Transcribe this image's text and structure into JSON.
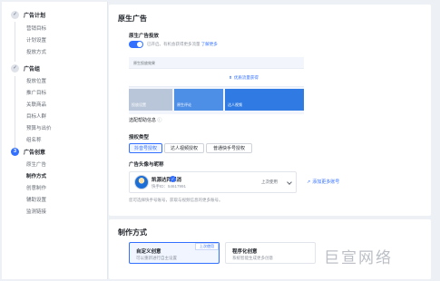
{
  "sidebar": {
    "groups": [
      {
        "title": "广告计划",
        "status": "done",
        "items": [
          "营销目标",
          "计划设置",
          "投放方式"
        ]
      },
      {
        "title": "广告组",
        "status": "done",
        "items": [
          "投放位置",
          "推广目标",
          "关联商品",
          "目标人群",
          "预算与出价",
          "组名称"
        ]
      },
      {
        "title": "广告创意",
        "status": "current",
        "step": "3",
        "items": [
          "原生广告",
          "制作方式",
          "创意制作",
          "辅助设置",
          "监测链接"
        ],
        "active_item": "制作方式"
      }
    ]
  },
  "native": {
    "section_title": "原生广告",
    "toggle_label": "原生广告投放",
    "toggle_on": true,
    "toggle_desc": "已开启。有机会获得更多流量",
    "learn_more": "了解更多",
    "preview": {
      "header": "原生投放效果",
      "cta": "优质流量获得",
      "cards": [
        "投放设置",
        "原生评论",
        "达人视频"
      ]
    },
    "help_label": "选配帮助信息",
    "auth_type_label": "授权类型",
    "auth_options": [
      "抖音号授权",
      "达人视频授权",
      "普通快手号授权"
    ],
    "auth_selected": 0,
    "avatar_label": "广告头像与昵称",
    "account": {
      "name": "凯源达拜课消",
      "id_label": "快手ID：54617991",
      "status": "上次使用"
    },
    "add_link": "添加更多账号",
    "hint": "您可选择快手号账号，获取与视频信息的更多账号。"
  },
  "production": {
    "section_title": "制作方式",
    "options": [
      {
        "title": "自定义创意",
        "desc": "可以重新进行自主设置",
        "badge": "上次使用",
        "selected": true
      },
      {
        "title": "程序化创意",
        "desc": "系统智能生成更多创意",
        "badge": "",
        "selected": false
      }
    ]
  },
  "watermark": "巨宣网络",
  "colors": {
    "accent": "#3370ff",
    "preview_blue": "#2f7be3"
  }
}
